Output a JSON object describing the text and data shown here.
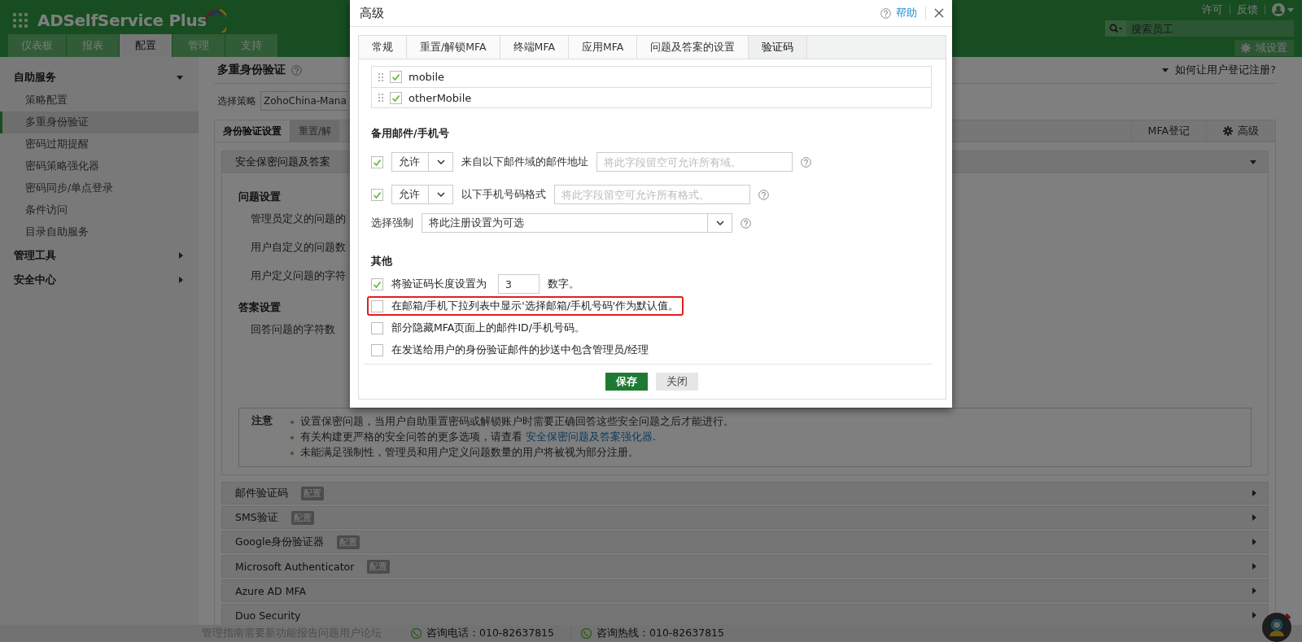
{
  "header": {
    "logo": "ADSelfService Plus",
    "tabs": [
      {
        "label": "仪表板",
        "selected": false
      },
      {
        "label": "报表",
        "selected": false
      },
      {
        "label": "配置",
        "selected": true
      },
      {
        "label": "管理",
        "selected": false
      },
      {
        "label": "支持",
        "selected": false
      }
    ],
    "links": [
      "许可",
      "反馈"
    ],
    "search": {
      "placeholder": "搜索员工"
    },
    "domain_button": "域设置"
  },
  "sidebar": {
    "groups": [
      {
        "label": "自助服务",
        "expanded": true,
        "items": [
          {
            "label": "策略配置",
            "selected": false
          },
          {
            "label": "多重身份验证",
            "selected": true
          },
          {
            "label": "密码过期提醒",
            "selected": false
          },
          {
            "label": "密码策略强化器",
            "selected": false
          },
          {
            "label": "密码同步/单点登录",
            "selected": false
          },
          {
            "label": "条件访问",
            "selected": false
          },
          {
            "label": "目录自助服务",
            "selected": false
          }
        ]
      },
      {
        "label": "管理工具",
        "expanded": false
      },
      {
        "label": "安全中心",
        "expanded": false
      }
    ]
  },
  "page": {
    "title": "多重身份验证",
    "help_link": "如何让用户登记注册?",
    "policy": {
      "label": "选择策略",
      "value": "ZohoChina-Mana"
    },
    "tabs": [
      {
        "label": "身份验证设置",
        "selected": true
      },
      {
        "label": "重置/解",
        "selected": false
      }
    ],
    "actions": [
      {
        "label": "MFA登记",
        "kind": "plain"
      },
      {
        "label": "高级",
        "kind": "settings"
      }
    ],
    "sections": [
      {
        "title": "安全保密问题及答案",
        "expanded": true,
        "groups": [
          {
            "heading": "问题设置",
            "fields": [
              "管理员定义的问题的",
              "用户自定义的问题数",
              "用户定义问题的字符"
            ]
          },
          {
            "heading": "答案设置",
            "fields": [
              "回答问题的字符数"
            ]
          }
        ],
        "note": {
          "label": "注意",
          "items": [
            {
              "text": "设置保密问题，当用户自助重置密码或解锁账户时需要正确回答这些安全问题之后才能进行。"
            },
            {
              "text": "有关构建更严格的安全问答的更多选项，请查看",
              "link": "安全保密问题及答案强化器",
              "tail": "."
            },
            {
              "text": "未能满足强制性，管理员和用户定义问题数量的用户将被视为部分注册。"
            }
          ]
        }
      },
      {
        "title": "邮件验证码",
        "expanded": false,
        "badge": "配置"
      },
      {
        "title": "SMS验证",
        "expanded": false,
        "badge": "配置"
      },
      {
        "title": "Google身份验证器",
        "expanded": false,
        "badge": "配置"
      },
      {
        "title": "Microsoft Authenticator",
        "expanded": false,
        "badge": "配置"
      },
      {
        "title": "Azure AD MFA",
        "expanded": false
      },
      {
        "title": "Duo Security",
        "expanded": false
      }
    ]
  },
  "footer": {
    "links_text": "管理指南需要新功能报告问题用户论坛",
    "contacts": [
      "咨询电话：010-82637815",
      "咨询热线：010-82637815"
    ]
  },
  "dialog": {
    "title": "高级",
    "help": "帮助",
    "tabs": [
      {
        "label": "常规",
        "selected": false
      },
      {
        "label": "重置/解锁MFA",
        "selected": false
      },
      {
        "label": "终端MFA",
        "selected": false
      },
      {
        "label": "应用MFA",
        "selected": false
      },
      {
        "label": "问题及答案的设置",
        "selected": false
      },
      {
        "label": "验证码",
        "selected": true
      }
    ],
    "attributes": [
      {
        "name": "mobile",
        "checked": true
      },
      {
        "name": "otherMobile",
        "checked": true
      }
    ],
    "backup_heading": "备用邮件/手机号",
    "backup_rows": [
      {
        "checked": true,
        "mode": "允许",
        "label": "来自以下邮件域的邮件地址",
        "placeholder": "将此字段留空可允许所有域。"
      },
      {
        "checked": true,
        "mode": "允许",
        "label": "以下手机号码格式",
        "placeholder": "将此字段留空可允许所有格式。"
      }
    ],
    "enforce": {
      "label": "选择强制",
      "value": "将此注册设置为可选"
    },
    "other_heading": "其他",
    "options": [
      {
        "kind": "length",
        "checked": true,
        "highlighted": false,
        "label": "将验证码长度设置为",
        "value": "3",
        "suffix": "数字。"
      },
      {
        "kind": "plain",
        "checked": false,
        "highlighted": true,
        "label": "在邮箱/手机下拉列表中显示'选择邮箱/手机号码'作为默认值。"
      },
      {
        "kind": "plain",
        "checked": false,
        "highlighted": false,
        "label": "部分隐藏MFA页面上的邮件ID/手机号码。"
      },
      {
        "kind": "plain",
        "checked": false,
        "highlighted": false,
        "label": "在发送给用户的身份验证邮件的抄送中包含管理员/经理"
      }
    ],
    "buttons": [
      {
        "label": "保存",
        "kind": "primary"
      },
      {
        "label": "关闭",
        "kind": "secondary"
      }
    ]
  }
}
